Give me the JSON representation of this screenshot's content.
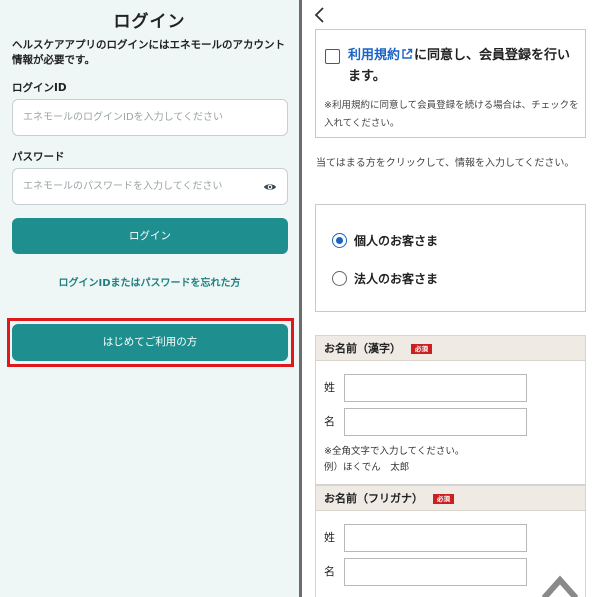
{
  "login": {
    "title": "ログイン",
    "intro": "ヘルスケアアプリのログインにはエネモールのアカウント情報が必要です。",
    "id_label": "ログインID",
    "id_placeholder": "エネモールのログインIDを入力してください",
    "password_label": "パスワード",
    "password_placeholder": "エネモールのパスワードを入力してください",
    "login_button": "ログイン",
    "forgot_link": "ログインIDまたはパスワードを忘れた方",
    "first_time_button": "はじめてご利用の方"
  },
  "registration": {
    "terms_link": "利用規約",
    "terms_text": "に同意し、会員登録を行います。",
    "terms_note": "※利用規約に同意して会員登録を続ける場合は、チェックを入れてください。",
    "choose_text": "当てはまる方をクリックして、情報を入力してください。",
    "customer_types": [
      {
        "label": "個人のお客さま",
        "selected": true
      },
      {
        "label": "法人のお客さま",
        "selected": false
      }
    ],
    "name_kanji": {
      "title": "お名前（漢字）",
      "required_badge": "必須",
      "last_label": "姓",
      "first_label": "名",
      "note_line1": "※全角文字で入力してください。",
      "note_line2": "例）ほくでん　太郎"
    },
    "name_kana": {
      "title": "お名前（フリガナ）",
      "required_badge": "必須",
      "last_label": "姓",
      "first_label": "名"
    }
  },
  "colors": {
    "accent_teal": "#1e8e8e",
    "link_blue": "#1a63c4",
    "highlight_red": "#e0181c",
    "required_red": "#cc1f1f"
  },
  "icons": [
    "eye-icon",
    "back-chevron-icon",
    "external-link-icon",
    "scroll-top-icon"
  ]
}
